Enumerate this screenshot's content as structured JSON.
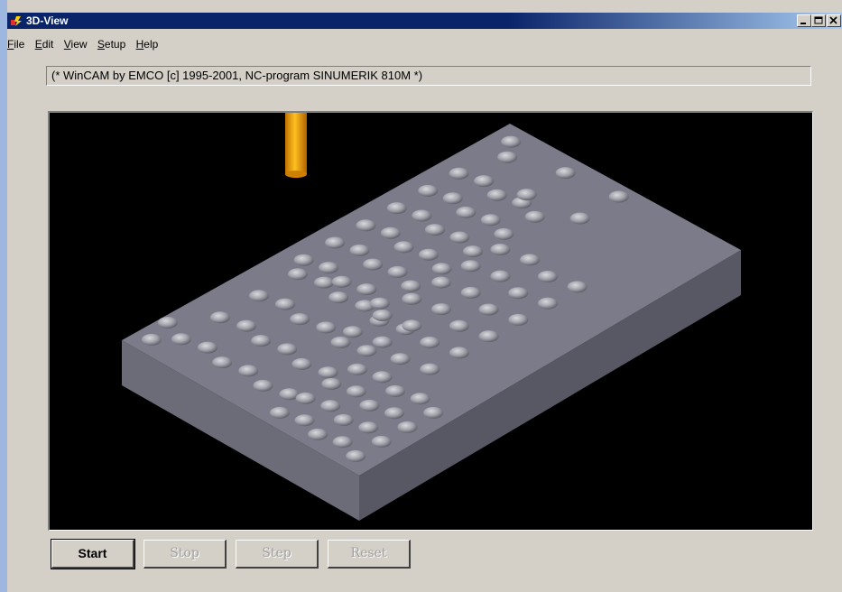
{
  "window": {
    "title": "3D-View"
  },
  "menu": [
    {
      "first": "F",
      "rest": "ile"
    },
    {
      "first": "E",
      "rest": "dit"
    },
    {
      "first": "V",
      "rest": "iew"
    },
    {
      "first": "S",
      "rest": "etup"
    },
    {
      "first": "H",
      "rest": "elp"
    }
  ],
  "program_line": "(* WinCAM by EMCO [c] 1995-2001,  NC-program SINUMERIK 810M   *)",
  "buttons": {
    "start": "Start",
    "stop": "Stop",
    "step": "Step",
    "reset": "Reset"
  },
  "colors": {
    "title_bar": "#0a246a",
    "block_top": "#7b7b8a",
    "tool": "#f0a000",
    "viewport_bg": "#000000"
  }
}
